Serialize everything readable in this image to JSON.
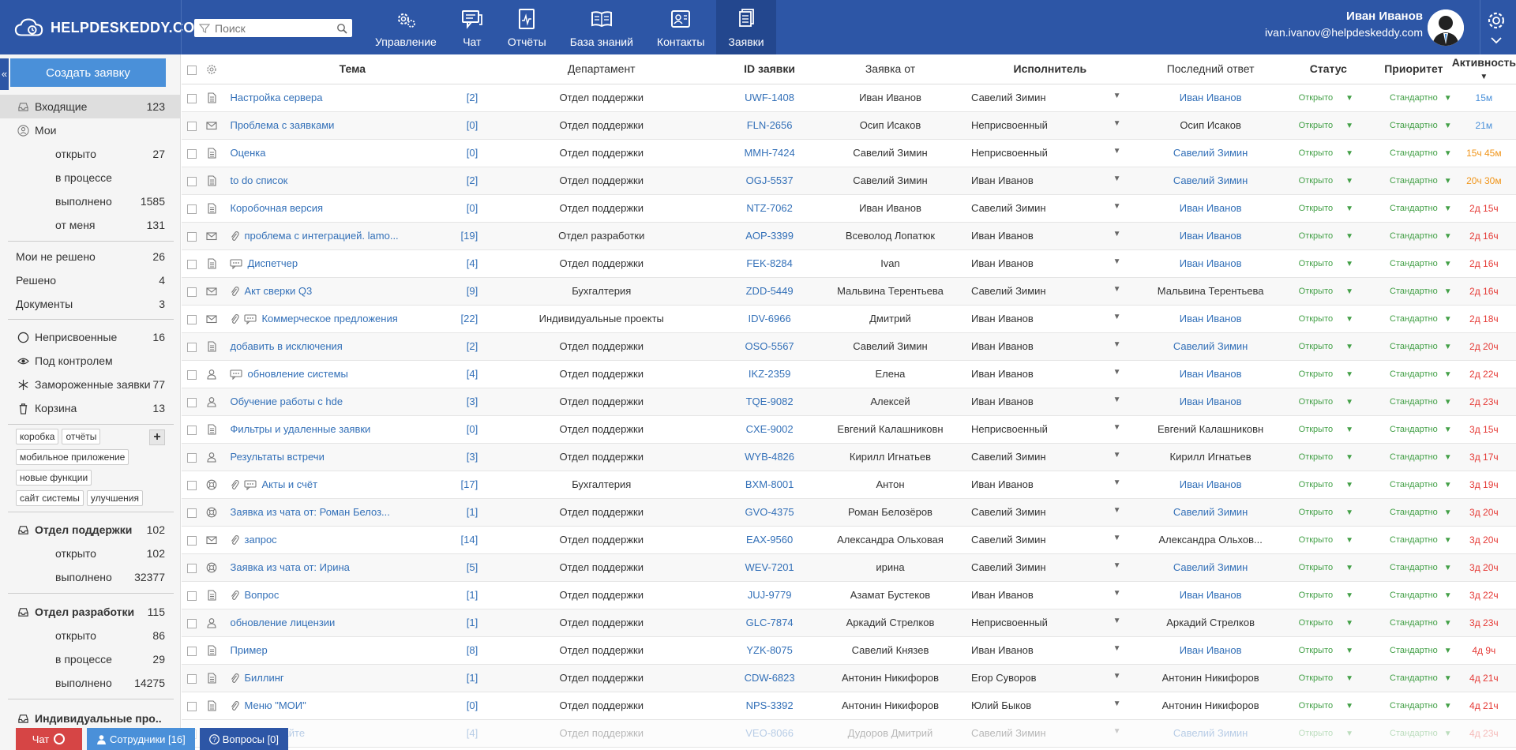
{
  "brand": {
    "logo_text": "HELPDESKEDDY.COM"
  },
  "search": {
    "placeholder": "Поиск"
  },
  "nav": [
    {
      "label": "Управление",
      "icon": "gears-icon"
    },
    {
      "label": "Чат",
      "icon": "chat-icon"
    },
    {
      "label": "Отчёты",
      "icon": "reports-icon"
    },
    {
      "label": "База знаний",
      "icon": "book-icon"
    },
    {
      "label": "Контакты",
      "icon": "contacts-icon"
    },
    {
      "label": "Заявки",
      "icon": "tickets-icon",
      "active": true
    }
  ],
  "user": {
    "name": "Иван Иванов",
    "email": "ivan.ivanov@helpdeskeddy.com"
  },
  "sidebar": {
    "collapse_label": "«",
    "create_button": "Создать заявку",
    "inbox": {
      "label": "Входящие",
      "count": "123"
    },
    "mine": {
      "label": "Мои"
    },
    "mine_items": [
      {
        "label": "открыто",
        "count": "27"
      },
      {
        "label": "в процессе",
        "count": ""
      },
      {
        "label": "выполнено",
        "count": "1585"
      },
      {
        "label": "от меня",
        "count": "131"
      }
    ],
    "group2": [
      {
        "label": "Мои не решено",
        "count": "26"
      },
      {
        "label": "Решено",
        "count": "4"
      },
      {
        "label": "Документы",
        "count": "3"
      }
    ],
    "group3": [
      {
        "label": "Неприсвоенные",
        "count": "16",
        "icon": "circle-icon"
      },
      {
        "label": "Под контролем",
        "count": "",
        "icon": "eye-icon"
      },
      {
        "label": "Замороженные заявки",
        "count": "77",
        "icon": "snowflake-icon"
      },
      {
        "label": "Корзина",
        "count": "13",
        "icon": "trash-icon"
      }
    ],
    "tags": [
      "коробка",
      "отчёты",
      "мобильное приложение",
      "новые функции",
      "сайт системы",
      "улучшения"
    ],
    "tag_add": "+",
    "departments": [
      {
        "label": "Отдел поддержки",
        "count": "102",
        "items": [
          {
            "label": "открыто",
            "count": "102"
          },
          {
            "label": "выполнено",
            "count": "32377"
          }
        ]
      },
      {
        "label": "Отдел разработки",
        "count": "115",
        "items": [
          {
            "label": "открыто",
            "count": "86"
          },
          {
            "label": "в процессе",
            "count": "29"
          },
          {
            "label": "выполнено",
            "count": "14275"
          }
        ]
      },
      {
        "label": "Индивидуальные про..",
        "count": "",
        "items": []
      }
    ]
  },
  "table": {
    "columns": [
      "Тема",
      "Департамент",
      "ID заявки",
      "Заявка от",
      "Исполнитель",
      "Последний ответ",
      "Статус",
      "Приоритет",
      "Активность"
    ],
    "sort_indicator": "▼",
    "rows": [
      {
        "type": "doc",
        "attach": false,
        "chat": false,
        "subject": "Настройка сервера",
        "cnt": "[2]",
        "dept": "Отдел поддержки",
        "id": "UWF-1408",
        "from": "Иван Иванов",
        "assignee": "Савелий Зимин",
        "last": "Иван Иванов",
        "last_link": true,
        "status": "Открыто",
        "priority": "Стандартно",
        "activity": "15м",
        "act_color": "blue"
      },
      {
        "type": "mail",
        "attach": false,
        "chat": false,
        "subject": "Проблема с заявками",
        "cnt": "[0]",
        "dept": "Отдел поддержки",
        "id": "FLN-2656",
        "from": "Осип Исаков",
        "assignee": "Неприсвоенный",
        "last": "Осип Исаков",
        "last_link": false,
        "status": "Открыто",
        "priority": "Стандартно",
        "activity": "21м",
        "act_color": "blue"
      },
      {
        "type": "doc",
        "attach": false,
        "chat": false,
        "subject": "Оценка",
        "cnt": "[0]",
        "dept": "Отдел поддержки",
        "id": "MMH-7424",
        "from": "Савелий Зимин",
        "assignee": "Неприсвоенный",
        "last": "Савелий Зимин",
        "last_link": true,
        "status": "Открыто",
        "priority": "Стандартно",
        "activity": "15ч 45м",
        "act_color": "orange"
      },
      {
        "type": "doc",
        "attach": false,
        "chat": false,
        "subject": "to do список",
        "cnt": "[2]",
        "dept": "Отдел поддержки",
        "id": "OGJ-5537",
        "from": "Савелий Зимин",
        "assignee": "Иван Иванов",
        "last": "Савелий Зимин",
        "last_link": true,
        "status": "Открыто",
        "priority": "Стандартно",
        "activity": "20ч 30м",
        "act_color": "orange"
      },
      {
        "type": "doc",
        "attach": false,
        "chat": false,
        "subject": "Коробочная версия",
        "cnt": "[0]",
        "dept": "Отдел поддержки",
        "id": "NTZ-7062",
        "from": "Иван Иванов",
        "assignee": "Савелий Зимин",
        "last": "Иван Иванов",
        "last_link": true,
        "status": "Открыто",
        "priority": "Стандартно",
        "activity": "2д 15ч",
        "act_color": "red"
      },
      {
        "type": "mail",
        "attach": true,
        "chat": false,
        "subject": "проблема с интеграцией. lamo...",
        "cnt": "[19]",
        "dept": "Отдел разработки",
        "id": "AOP-3399",
        "from": "Всеволод Лопатюк",
        "assignee": "Иван Иванов",
        "last": "Иван Иванов",
        "last_link": true,
        "status": "Открыто",
        "priority": "Стандартно",
        "activity": "2д 16ч",
        "act_color": "red"
      },
      {
        "type": "doc",
        "attach": false,
        "chat": true,
        "subject": "Диспетчер",
        "cnt": "[4]",
        "dept": "Отдел поддержки",
        "id": "FEK-8284",
        "from": "Ivan",
        "assignee": "Иван Иванов",
        "last": "Иван Иванов",
        "last_link": true,
        "status": "Открыто",
        "priority": "Стандартно",
        "activity": "2д 16ч",
        "act_color": "red"
      },
      {
        "type": "mail",
        "attach": true,
        "chat": false,
        "subject": "Акт сверки Q3",
        "cnt": "[9]",
        "dept": "Бухгалтерия",
        "id": "ZDD-5449",
        "from": "Мальвина Терентьева",
        "assignee": "Савелий Зимин",
        "last": "Мальвина Терентьева",
        "last_link": false,
        "status": "Открыто",
        "priority": "Стандартно",
        "activity": "2д 16ч",
        "act_color": "red"
      },
      {
        "type": "mail",
        "attach": true,
        "chat": true,
        "subject": "Коммерческое предложения",
        "cnt": "[22]",
        "dept": "Индивидуальные проекты",
        "id": "IDV-6966",
        "from": "Дмитрий",
        "assignee": "Иван Иванов",
        "last": "Иван Иванов",
        "last_link": true,
        "status": "Открыто",
        "priority": "Стандартно",
        "activity": "2д 18ч",
        "act_color": "red"
      },
      {
        "type": "doc",
        "attach": false,
        "chat": false,
        "subject": "добавить в исключения",
        "cnt": "[2]",
        "dept": "Отдел поддержки",
        "id": "OSO-5567",
        "from": "Савелий Зимин",
        "assignee": "Иван Иванов",
        "last": "Савелий Зимин",
        "last_link": true,
        "status": "Открыто",
        "priority": "Стандартно",
        "activity": "2д 20ч",
        "act_color": "red"
      },
      {
        "type": "person",
        "attach": false,
        "chat": true,
        "subject": "обновление системы",
        "cnt": "[4]",
        "dept": "Отдел поддержки",
        "id": "IKZ-2359",
        "from": "Елена",
        "assignee": "Иван Иванов",
        "last": "Иван Иванов",
        "last_link": true,
        "status": "Открыто",
        "priority": "Стандартно",
        "activity": "2д 22ч",
        "act_color": "red"
      },
      {
        "type": "person",
        "attach": false,
        "chat": false,
        "subject": "Обучение работы с hde",
        "cnt": "[3]",
        "dept": "Отдел поддержки",
        "id": "TQE-9082",
        "from": "Алексей",
        "assignee": "Иван Иванов",
        "last": "Иван Иванов",
        "last_link": true,
        "status": "Открыто",
        "priority": "Стандартно",
        "activity": "2д 23ч",
        "act_color": "red"
      },
      {
        "type": "doc",
        "attach": false,
        "chat": false,
        "subject": "Фильтры и удаленные заявки",
        "cnt": "[0]",
        "dept": "Отдел поддержки",
        "id": "CXE-9002",
        "from": "Евгений Калашниковн",
        "assignee": "Неприсвоенный",
        "last": "Евгений Калашниковн",
        "last_link": false,
        "status": "Открыто",
        "priority": "Стандартно",
        "activity": "3д 15ч",
        "act_color": "red"
      },
      {
        "type": "person",
        "attach": false,
        "chat": false,
        "subject": "Результаты встречи",
        "cnt": "[3]",
        "dept": "Отдел поддержки",
        "id": "WYB-4826",
        "from": "Кирилл Игнатьев",
        "assignee": "Савелий Зимин",
        "last": "Кирилл Игнатьев",
        "last_link": false,
        "status": "Открыто",
        "priority": "Стандартно",
        "activity": "3д 17ч",
        "act_color": "red"
      },
      {
        "type": "lifebuoy",
        "attach": true,
        "chat": true,
        "subject": "Акты и счёт",
        "cnt": "[17]",
        "dept": "Бухгалтерия",
        "id": "BXM-8001",
        "from": "Антон",
        "assignee": "Иван Иванов",
        "last": "Иван Иванов",
        "last_link": true,
        "status": "Открыто",
        "priority": "Стандартно",
        "activity": "3д 19ч",
        "act_color": "red"
      },
      {
        "type": "lifebuoy",
        "attach": false,
        "chat": false,
        "subject": "Заявка из чата от: Роман Белоз...",
        "cnt": "[1]",
        "dept": "Отдел поддержки",
        "id": "GVO-4375",
        "from": "Роман Белозёров",
        "assignee": "Савелий Зимин",
        "last": "Савелий Зимин",
        "last_link": true,
        "status": "Открыто",
        "priority": "Стандартно",
        "activity": "3д 20ч",
        "act_color": "red"
      },
      {
        "type": "mail",
        "attach": true,
        "chat": false,
        "subject": "запрос",
        "cnt": "[14]",
        "dept": "Отдел поддержки",
        "id": "EAX-9560",
        "from": "Александра Ольховая",
        "assignee": "Савелий Зимин",
        "last": "Александра Ольхов...",
        "last_link": false,
        "status": "Открыто",
        "priority": "Стандартно",
        "activity": "3д 20ч",
        "act_color": "red"
      },
      {
        "type": "lifebuoy",
        "attach": false,
        "chat": false,
        "subject": "Заявка из чата от: Ирина",
        "cnt": "[5]",
        "dept": "Отдел поддержки",
        "id": "WEV-7201",
        "from": "ирина",
        "assignee": "Савелий Зимин",
        "last": "Савелий Зимин",
        "last_link": true,
        "status": "Открыто",
        "priority": "Стандартно",
        "activity": "3д 20ч",
        "act_color": "red"
      },
      {
        "type": "doc",
        "attach": true,
        "chat": false,
        "subject": "Вопрос",
        "cnt": "[1]",
        "dept": "Отдел поддержки",
        "id": "JUJ-9779",
        "from": "Азамат Бустеков",
        "assignee": "Иван Иванов",
        "last": "Иван Иванов",
        "last_link": true,
        "status": "Открыто",
        "priority": "Стандартно",
        "activity": "3д 22ч",
        "act_color": "red"
      },
      {
        "type": "person",
        "attach": false,
        "chat": false,
        "subject": "обновление лицензии",
        "cnt": "[1]",
        "dept": "Отдел поддержки",
        "id": "GLC-7874",
        "from": "Аркадий Стрелков",
        "assignee": "Неприсвоенный",
        "last": "Аркадий Стрелков",
        "last_link": false,
        "status": "Открыто",
        "priority": "Стандартно",
        "activity": "3д 23ч",
        "act_color": "red"
      },
      {
        "type": "doc",
        "attach": false,
        "chat": false,
        "subject": "Пример",
        "cnt": "[8]",
        "dept": "Отдел поддержки",
        "id": "YZK-8075",
        "from": "Савелий Князев",
        "assignee": "Иван Иванов",
        "last": "Иван Иванов",
        "last_link": true,
        "status": "Открыто",
        "priority": "Стандартно",
        "activity": "4д 9ч",
        "act_color": "red"
      },
      {
        "type": "doc",
        "attach": true,
        "chat": false,
        "subject": "Биллинг",
        "cnt": "[1]",
        "dept": "Отдел поддержки",
        "id": "CDW-6823",
        "from": "Антонин Никифоров",
        "assignee": "Егор Суворов",
        "last": "Антонин Никифоров",
        "last_link": false,
        "status": "Открыто",
        "priority": "Стандартно",
        "activity": "4д 21ч",
        "act_color": "red"
      },
      {
        "type": "doc",
        "attach": true,
        "chat": false,
        "subject": "Меню \"МОИ\"",
        "cnt": "[0]",
        "dept": "Отдел поддержки",
        "id": "NPS-3392",
        "from": "Антонин Никифоров",
        "assignee": "Юлий Быков",
        "last": "Антонин Никифоров",
        "last_link": false,
        "status": "Открыто",
        "priority": "Стандартно",
        "activity": "4д 21ч",
        "act_color": "red"
      },
      {
        "type": "doc",
        "attach": false,
        "chat": false,
        "subject": "... Вашем сайте",
        "cnt": "[4]",
        "dept": "Отдел поддержки",
        "id": "VEO-8066",
        "from": "Дудоров Дмитрий",
        "assignee": "Савелий Зимин",
        "last": "Савелий Зимин",
        "last_link": true,
        "status": "Открыто",
        "priority": "Стандартно",
        "activity": "4д 23ч",
        "act_color": "red",
        "faded": true
      }
    ]
  },
  "bottom_bar": {
    "chat": "Чат",
    "staff": "Сотрудники [16]",
    "questions": "Вопросы [0]"
  }
}
